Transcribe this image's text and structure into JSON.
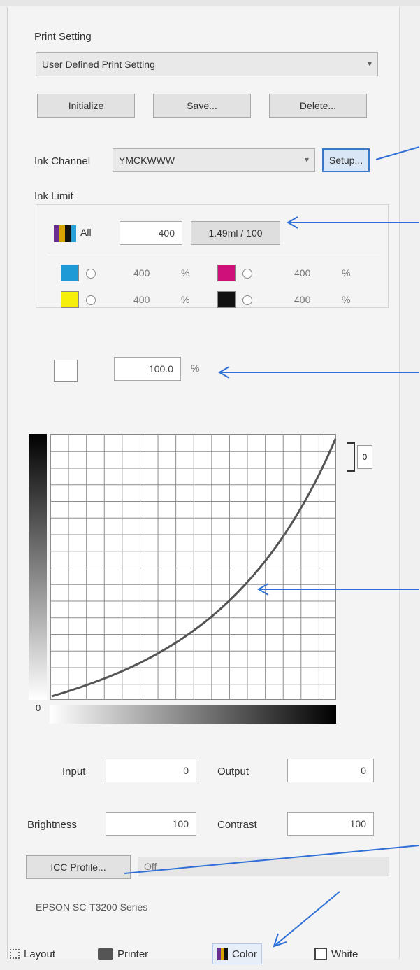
{
  "print_setting": {
    "section_label": "Print Setting",
    "preset_value": "User Defined Print Setting",
    "buttons": [
      "Initialize",
      "Save...",
      "Delete..."
    ]
  },
  "ink_channel": {
    "label": "Ink Channel",
    "value": "YMCKWWW",
    "setup_button": "Setup..."
  },
  "ink_limit": {
    "label": "Ink Limit",
    "all_check": "All",
    "all_value": "400",
    "all_units": "1.49ml / 100",
    "channels": [
      {
        "color": "#1e9ad6",
        "value": "400",
        "unit": "%"
      },
      {
        "color": "#d0107a",
        "value": "400",
        "unit": "%"
      },
      {
        "color": "#f5ef0a",
        "value": "400",
        "unit": "%"
      },
      {
        "color": "#111111",
        "value": "400",
        "unit": "%"
      }
    ]
  },
  "percentage": {
    "value": "100.0",
    "unit": "%"
  },
  "curve": {
    "zero_label": "0",
    "side_value": "0"
  },
  "input_output": {
    "input_label": "Input",
    "input_value": "0",
    "output_label": "Output",
    "output_value": "0"
  },
  "brightness_contrast": {
    "brightness_label": "Brightness",
    "brightness_value": "100",
    "contrast_label": "Contrast",
    "contrast_value": "100"
  },
  "icc": {
    "button": "ICC Profile...",
    "value": "Off",
    "profile": "EPSON SC-T3200 Series"
  },
  "tabs": [
    "Layout",
    "Printer",
    "Color",
    "White"
  ],
  "annotation_color": "#2f6fd6"
}
